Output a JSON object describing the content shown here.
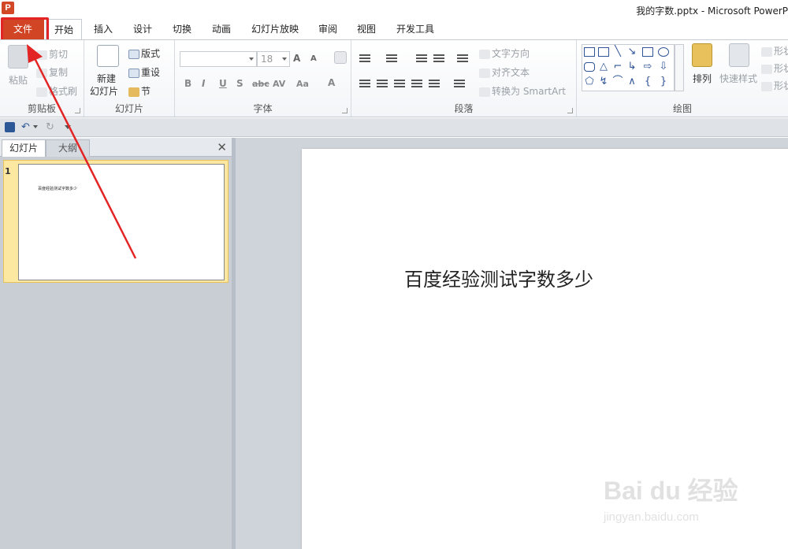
{
  "window": {
    "title": "我的字数.pptx - Microsoft PowerP",
    "app_icon": "P"
  },
  "tabs": [
    {
      "label": "文件"
    },
    {
      "label": "开始"
    },
    {
      "label": "插入"
    },
    {
      "label": "设计"
    },
    {
      "label": "切换"
    },
    {
      "label": "动画"
    },
    {
      "label": "幻灯片放映"
    },
    {
      "label": "审阅"
    },
    {
      "label": "视图"
    },
    {
      "label": "开发工具"
    }
  ],
  "ribbon": {
    "clipboard": {
      "label": "剪贴板",
      "paste": "粘贴",
      "cut": "剪切",
      "copy": "复制",
      "format_painter": "格式刷"
    },
    "slides": {
      "label": "幻灯片",
      "new_slide_line1": "新建",
      "new_slide_line2": "幻灯片",
      "layout": "版式",
      "reset": "重设",
      "section": "节"
    },
    "font": {
      "label": "字体",
      "size": "18",
      "bold": "B",
      "italic": "I",
      "underline": "U",
      "strike": "S",
      "abc": "abc",
      "av": "AV",
      "aa": "Aa",
      "a": "A",
      "grow": "A",
      "shrink": "A"
    },
    "paragraph": {
      "label": "段落",
      "text_direction": "文字方向",
      "align_text": "对齐文本",
      "convert_smartart": "转换为 SmartArt"
    },
    "drawing": {
      "label": "绘图",
      "arrange": "排列",
      "quick_styles": "快速样式",
      "shape_fill": "形状",
      "shape_outline": "形状",
      "shape_effects": "形状"
    }
  },
  "left_pane": {
    "tab_slides": "幻灯片",
    "tab_outline": "大纲",
    "close": "✕",
    "slide_number": "1",
    "thumb_text": "百度经验测试字数多少"
  },
  "slide": {
    "text": "百度经验测试字数多少"
  },
  "watermark": {
    "brand": "Bai du 经验",
    "url": "jingyan.baidu.com"
  },
  "colors": {
    "file_tab": "#d14424",
    "highlight": "#e32424",
    "selected_thumb": "#fce8a0"
  }
}
